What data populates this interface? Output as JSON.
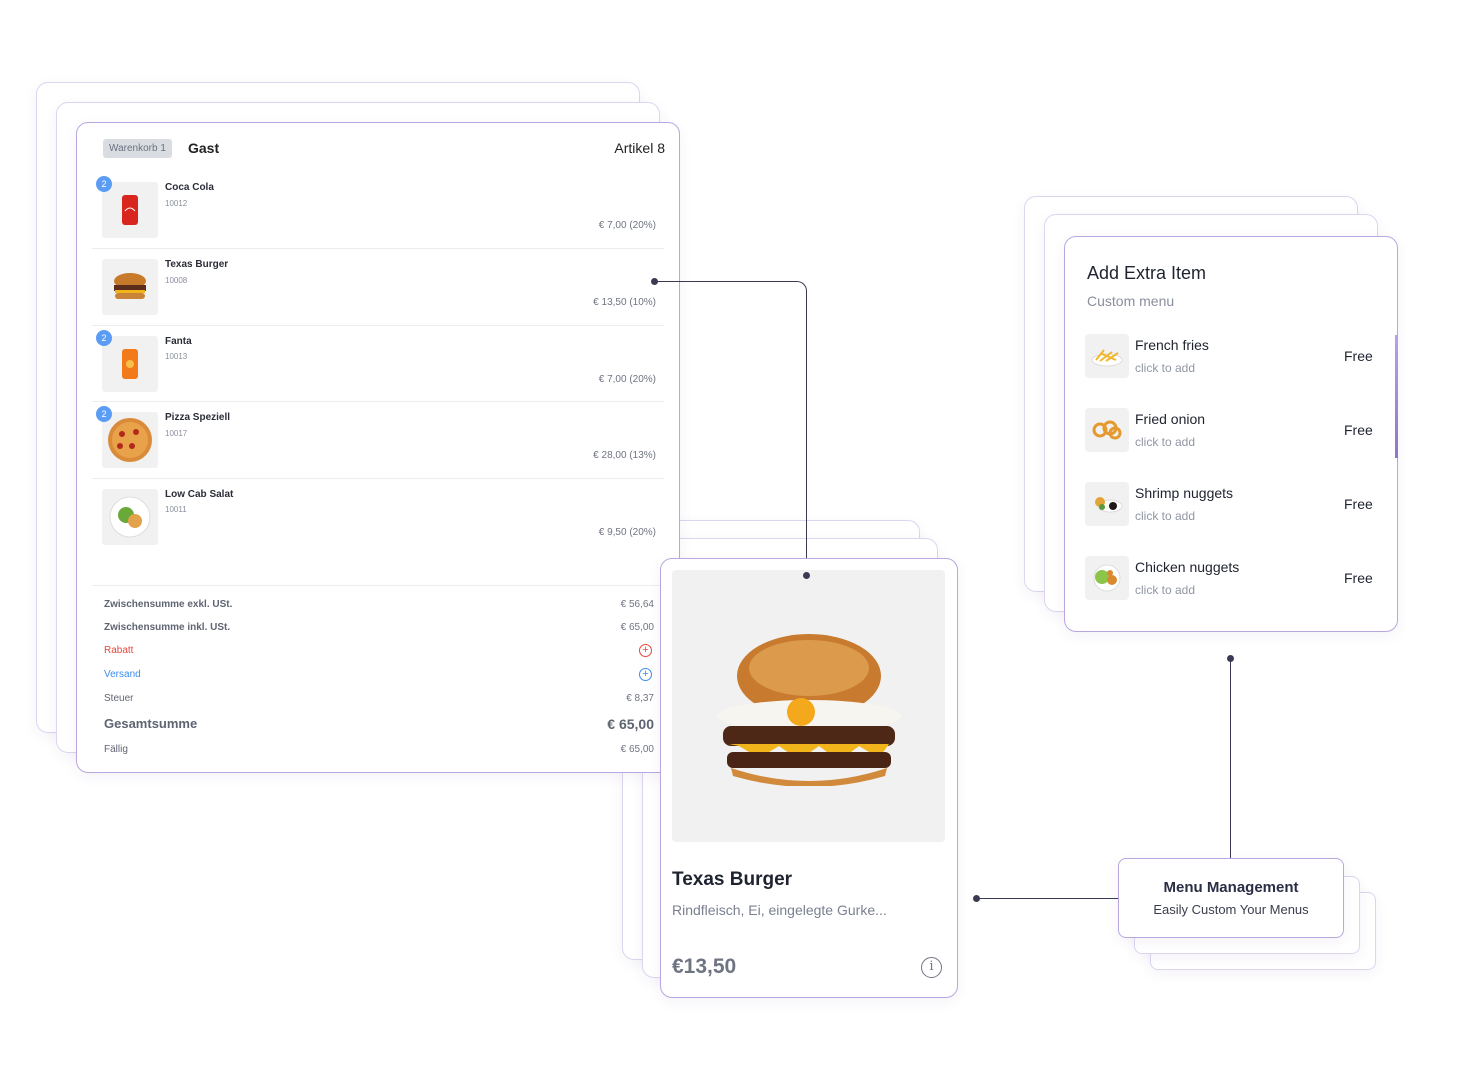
{
  "cart": {
    "tag": "Warenkorb 1",
    "customer": "Gast",
    "count_label": "Artikel 8",
    "items": [
      {
        "name": "Coca Cola",
        "code": "10012",
        "price": "€ 7,00 (20%)",
        "qty": "2",
        "image": "cola-can"
      },
      {
        "name": "Texas Burger",
        "code": "10008",
        "price": "€ 13,50 (10%)",
        "qty": null,
        "image": "burger"
      },
      {
        "name": "Fanta",
        "code": "10013",
        "price": "€ 7,00 (20%)",
        "qty": "2",
        "image": "fanta-can"
      },
      {
        "name": "Pizza Speziell",
        "code": "10017",
        "price": "€ 28,00 (13%)",
        "qty": "2",
        "image": "pizza"
      },
      {
        "name": "Low Cab Salat",
        "code": "10011",
        "price": "€ 9,50 (20%)",
        "qty": null,
        "image": "salad"
      }
    ],
    "summary": {
      "subtotal_excl_label": "Zwischensumme exkl. USt.",
      "subtotal_excl": "€ 56,64",
      "subtotal_incl_label": "Zwischensumme inkl. USt.",
      "subtotal_incl": "€ 65,00",
      "discount_label": "Rabatt",
      "shipping_label": "Versand",
      "tax_label": "Steuer",
      "tax": "€ 8,37",
      "total_label": "Gesamtsumme",
      "total": "€ 65,00",
      "due_label": "Fällig",
      "due": "€ 65,00"
    },
    "colors": {
      "discount": "#e8473c",
      "shipping": "#3d8cf0",
      "badge": "#5b9cf5"
    }
  },
  "product": {
    "name": "Texas Burger",
    "description": "Rindfleisch, Ei, eingelegte Gurke...",
    "price": "€13,50",
    "image": "burger"
  },
  "extras": {
    "title": "Add Extra Item",
    "subtitle": "Custom menu",
    "items": [
      {
        "name": "French fries",
        "action": "click to add",
        "price": "Free",
        "image": "fries"
      },
      {
        "name": "Fried onion",
        "action": "click to add",
        "price": "Free",
        "image": "onion-rings"
      },
      {
        "name": "Shrimp nuggets",
        "action": "click to add",
        "price": "Free",
        "image": "shrimp"
      },
      {
        "name": "Chicken nuggets",
        "action": "click to add",
        "price": "Free",
        "image": "chicken"
      }
    ]
  },
  "feature": {
    "title": "Menu Management",
    "subtitle": "Easily Custom Your Menus"
  },
  "accent": "#b9a7e0"
}
